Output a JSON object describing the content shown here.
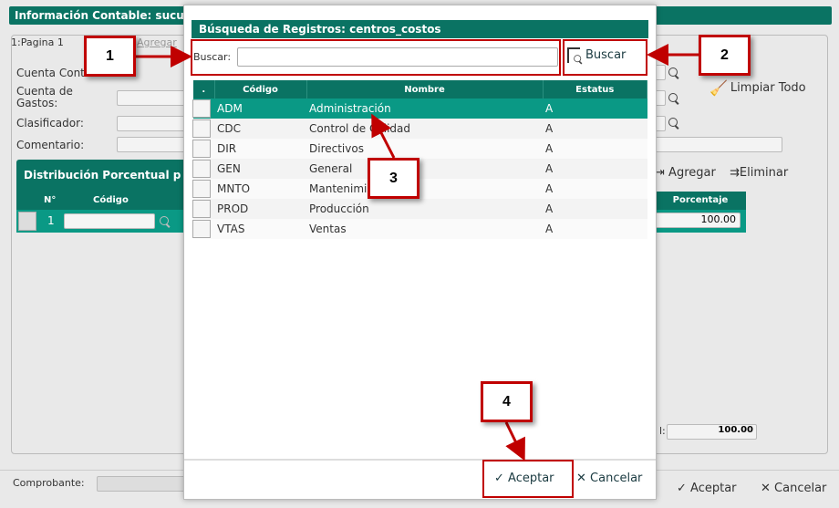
{
  "background": {
    "title": "Información Contable: sucu",
    "tab": "1:Pagina 1",
    "tab_add": "Agregar",
    "labels": {
      "cuenta_contable": "Cuenta Cont",
      "cuenta_gastos": "Cuenta de Gastos:",
      "clasificador": "Clasificador:",
      "comentario": "Comentario:"
    },
    "limpiar": "Limpiar Todo",
    "distribucion_title": "Distribución Porcentual p",
    "agregar": "Agregar",
    "eliminar": "Eliminar",
    "grid_headers": {
      "num": "N°",
      "codigo": "Código",
      "porcentaje": "Porcentaje"
    },
    "row": {
      "num": "1",
      "porcentaje": "100.00"
    },
    "total_label": "l:",
    "total_value": "100.00",
    "comprobante": "Comprobante:",
    "aceptar": "Aceptar",
    "cancelar": "Cancelar"
  },
  "modal": {
    "title": "Búsqueda de Registros: centros_costos",
    "search_label": "Buscar:",
    "search_value": "",
    "search_button": "Buscar",
    "headers": [
      ".",
      "Código",
      "Nombre",
      "Estatus"
    ],
    "rows": [
      {
        "codigo": "ADM",
        "nombre": "Administración",
        "estatus": "A"
      },
      {
        "codigo": "CDC",
        "nombre": "Control de Calidad",
        "estatus": "A"
      },
      {
        "codigo": "DIR",
        "nombre": "Directivos",
        "estatus": "A"
      },
      {
        "codigo": "GEN",
        "nombre": "General",
        "estatus": "A"
      },
      {
        "codigo": "MNTO",
        "nombre": "Mantenimiento",
        "estatus": "A"
      },
      {
        "codigo": "PROD",
        "nombre": "Producción",
        "estatus": "A"
      },
      {
        "codigo": "VTAS",
        "nombre": "Ventas",
        "estatus": "A"
      }
    ],
    "aceptar": "Aceptar",
    "cancelar": "Cancelar"
  },
  "callouts": [
    "1",
    "2",
    "3",
    "4"
  ],
  "colors": {
    "teal": "#0a7363",
    "selected_row": "#0a9985",
    "callout_red": "#c00000"
  }
}
